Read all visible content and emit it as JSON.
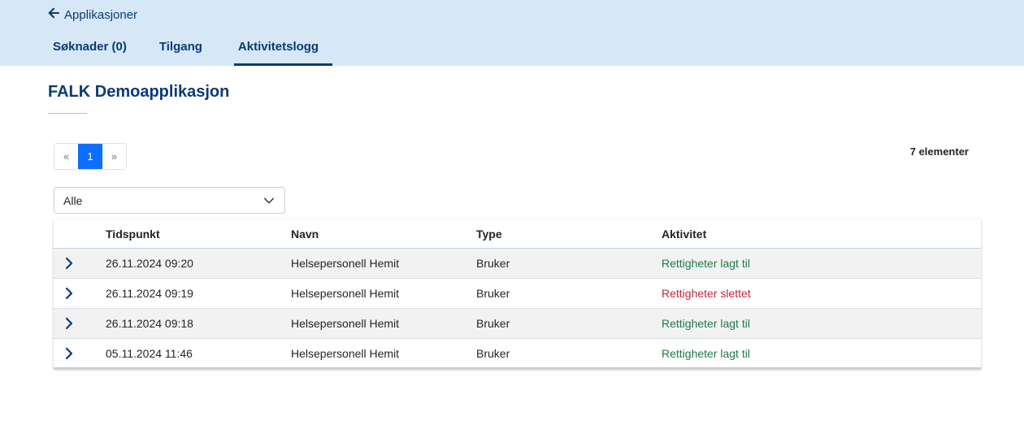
{
  "header": {
    "back_label": "Applikasjoner",
    "tabs": [
      {
        "label": "Søknader (0)"
      },
      {
        "label": "Tilgang"
      },
      {
        "label": "Aktivitetslogg"
      }
    ]
  },
  "main": {
    "title": "FALK Demoapplikasjon",
    "pagination": {
      "prev": "«",
      "current": "1",
      "next": "»"
    },
    "count": "7 elementer",
    "filter": {
      "selected": "Alle"
    },
    "table": {
      "columns": [
        "Tidspunkt",
        "Navn",
        "Type",
        "Aktivitet"
      ],
      "rows": [
        {
          "time": "26.11.2024 09:20",
          "name": "Helsepersonell Hemit",
          "type": "Bruker",
          "activity": "Rettigheter lagt til"
        },
        {
          "time": "26.11.2024 09:19",
          "name": "Helsepersonell Hemit",
          "type": "Bruker",
          "activity": "Rettigheter slettet"
        },
        {
          "time": "26.11.2024 09:18",
          "name": "Helsepersonell Hemit",
          "type": "Bruker",
          "activity": "Rettigheter lagt til"
        },
        {
          "time": "05.11.2024 11:46",
          "name": "Helsepersonell Hemit",
          "type": "Bruker",
          "activity": "Rettigheter lagt til"
        }
      ]
    }
  },
  "colors": {
    "header_bg": "#d6e8f5",
    "primary": "#0b3a75",
    "accent": "#0d6efd",
    "added": "#1e7b45",
    "removed": "#c0293a"
  },
  "icons": {
    "back": "arrow-left-icon",
    "dropdown": "chevron-down-icon",
    "expand": "chevron-right-icon"
  }
}
